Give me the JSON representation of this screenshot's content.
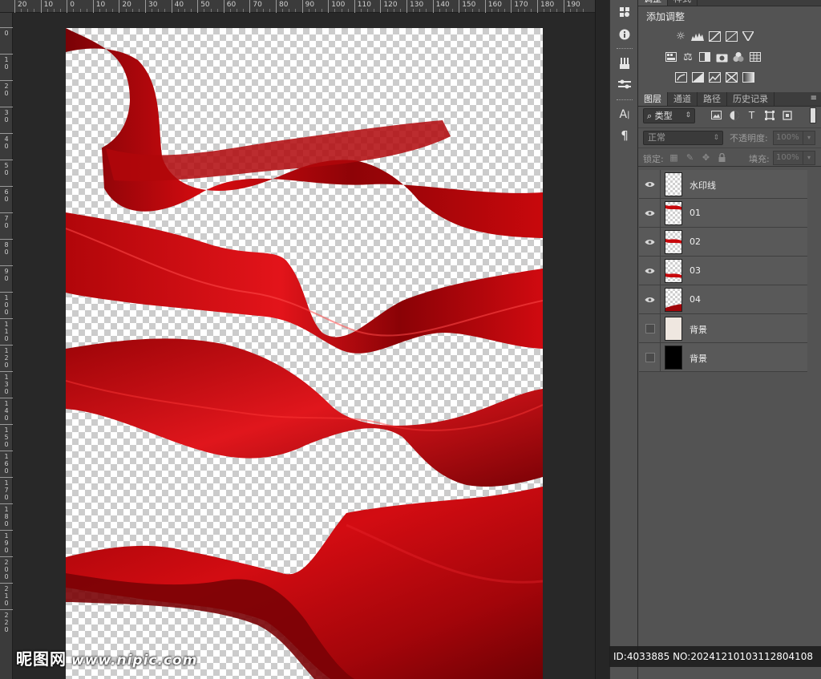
{
  "ruler": {
    "top_labels": [
      "20",
      "10",
      "0",
      "10",
      "20",
      "30",
      "40",
      "50",
      "60",
      "70",
      "80",
      "90",
      "100",
      "110",
      "120",
      "130",
      "140",
      "150",
      "160",
      "170",
      "180",
      "190"
    ],
    "left_labels": [
      "0",
      "10",
      "20",
      "30",
      "40",
      "50",
      "60",
      "70",
      "80",
      "90",
      "100",
      "110",
      "120",
      "130",
      "140",
      "150",
      "160",
      "170",
      "180",
      "190",
      "200",
      "210",
      "220"
    ]
  },
  "panel_top": {
    "tabs": [
      "调整",
      "样式"
    ],
    "title": "添加调整"
  },
  "layers_panel": {
    "tabs": [
      "图层",
      "通道",
      "路径",
      "历史记录"
    ],
    "filter": {
      "label": "类型",
      "search_icon": "⌕"
    },
    "blend": {
      "mode": "正常",
      "opacity_label": "不透明度:",
      "opacity_value": "100%"
    },
    "lock": {
      "label": "锁定:",
      "fill_label": "填充:",
      "fill_value": "100%"
    },
    "layers": [
      {
        "name": "水印线",
        "visible": true,
        "thumb": "transparent"
      },
      {
        "name": "01",
        "visible": true,
        "thumb": "ribbon"
      },
      {
        "name": "02",
        "visible": true,
        "thumb": "ribbon"
      },
      {
        "name": "03",
        "visible": true,
        "thumb": "ribbon"
      },
      {
        "name": "04",
        "visible": true,
        "thumb": "ribbon"
      },
      {
        "name": "背景",
        "visible": false,
        "thumb": "cream"
      },
      {
        "name": "背景",
        "visible": false,
        "thumb": "black"
      }
    ]
  },
  "watermark": {
    "brand": "昵图网",
    "url": "www.nipic.com"
  },
  "image_id": "ID:4033885 NO:20241210103112804108",
  "colors": {
    "ribbon": "#c8080c",
    "ribbon_dark": "#7a0206",
    "cream": "#efe7e0",
    "panel": "#535353"
  }
}
